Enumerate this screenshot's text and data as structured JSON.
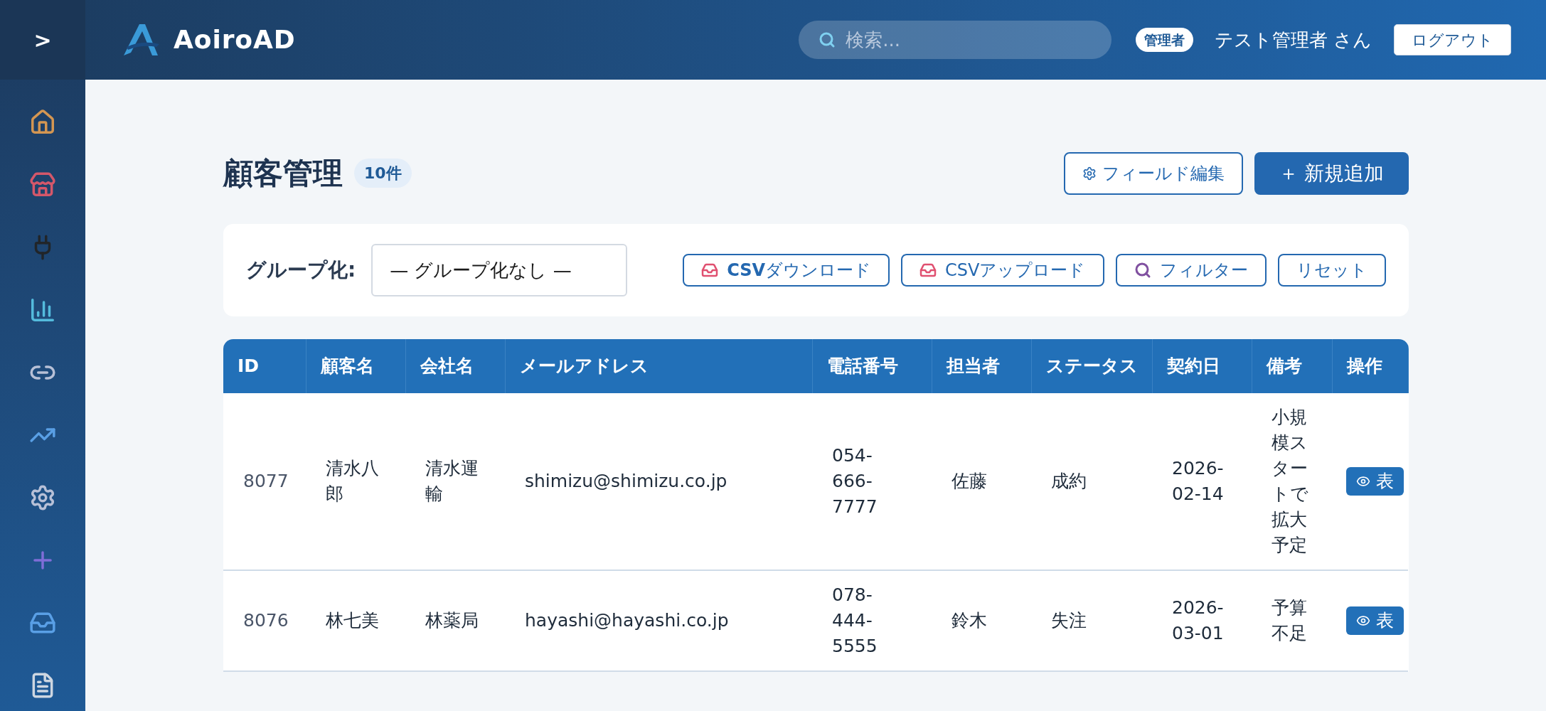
{
  "sidebar": {
    "toggle": ">",
    "items": [
      {
        "kind": "home"
      },
      {
        "kind": "store"
      },
      {
        "kind": "plug"
      },
      {
        "kind": "bars"
      },
      {
        "kind": "link"
      },
      {
        "kind": "trend"
      },
      {
        "kind": "gear"
      },
      {
        "kind": "plus"
      },
      {
        "kind": "inbox"
      },
      {
        "kind": "document"
      }
    ]
  },
  "header": {
    "logo": "AoiroAD",
    "search": {
      "placeholder": "検索..."
    },
    "role_badge": "管理者",
    "user": "テスト管理者 さん",
    "logout": "ログアウト"
  },
  "page": {
    "title": "顧客管理",
    "count": "10件",
    "field_edit": "フィールド編集",
    "add_new": "＋ 新規追加"
  },
  "toolbar": {
    "group_label": "グループ化:",
    "group_value": "— グループ化なし —",
    "buttons": [
      {
        "kind": "download",
        "label": "**CSV**ダウンロード"
      },
      {
        "kind": "upload",
        "label": "CSVアップロード"
      },
      {
        "kind": "search",
        "label": "フィルター"
      },
      {
        "kind": "plain",
        "label": "リセット"
      }
    ]
  },
  "table": {
    "columns": [
      "ID",
      "顧客名",
      "会社名",
      "メールアドレス",
      "電話番号",
      "担当者",
      "ステータス",
      "契約日",
      "備考",
      "操作"
    ],
    "rows": [
      {
        "cells": [
          "8077",
          "清水八郎",
          "清水運輸",
          "shimizu@shimizu.co.jp",
          "054-666-7777",
          "佐藤",
          "成約",
          "2026-02-14",
          "小規模スタートで拡大予定"
        ],
        "action": "表"
      },
      {
        "cells": [
          "8076",
          "林七美",
          "林薬局",
          "hayashi@hayashi.co.jp",
          "078-444-5555",
          "鈴木",
          "失注",
          "2026-03-01",
          "予算不足"
        ],
        "action": "表"
      }
    ]
  }
}
